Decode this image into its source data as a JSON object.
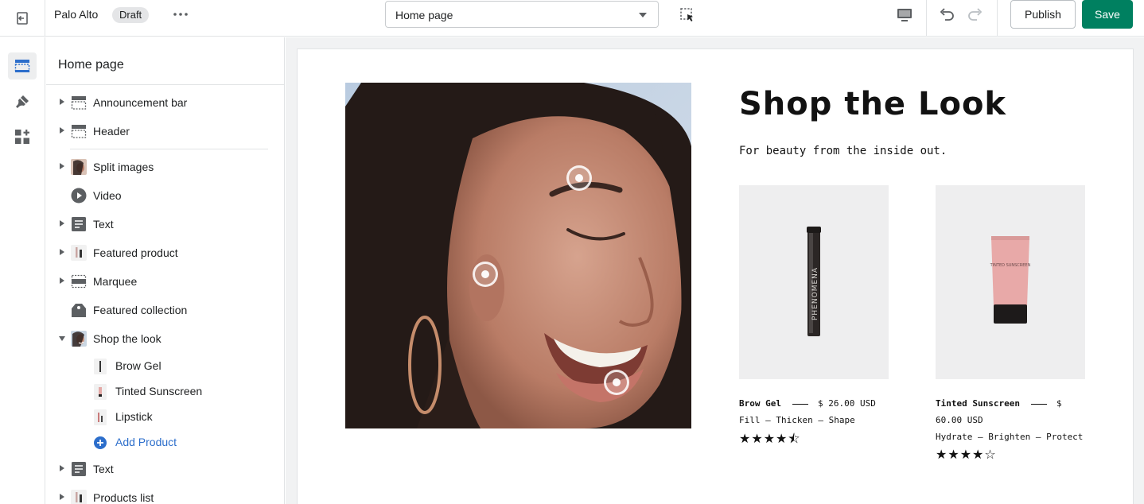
{
  "topbar": {
    "store_name": "Palo Alto",
    "status_badge": "Draft",
    "page_select": "Home page",
    "publish_label": "Publish",
    "save_label": "Save"
  },
  "sidebar": {
    "title": "Home page",
    "sections": [
      {
        "label": "Announcement bar",
        "icon": "section-icon"
      },
      {
        "label": "Header",
        "icon": "section-icon"
      },
      {
        "label": "Split images",
        "icon": "image-thumbnail"
      },
      {
        "label": "Video",
        "icon": "play-icon"
      },
      {
        "label": "Text",
        "icon": "text-icon"
      },
      {
        "label": "Featured product",
        "icon": "product-thumbnail"
      },
      {
        "label": "Marquee",
        "icon": "marquee-icon"
      },
      {
        "label": "Featured collection",
        "icon": "collection-tag-icon"
      },
      {
        "label": "Shop the look",
        "icon": "image-thumbnail"
      },
      {
        "label": "Text",
        "icon": "text-icon"
      },
      {
        "label": "Products list",
        "icon": "product-thumbnail"
      }
    ],
    "blocks": [
      {
        "label": "Brow Gel"
      },
      {
        "label": "Tinted Sunscreen"
      },
      {
        "label": "Lipstick"
      }
    ],
    "add_product": "Add Product"
  },
  "preview": {
    "title": "Shop the Look",
    "subtitle": "For beauty from the inside out.",
    "products": [
      {
        "name": "Brow Gel",
        "price_line1": "$ 26.00 USD",
        "price_line2": "",
        "tagline": "Fill – Thicken – Shape",
        "rating": 4.5,
        "stars": "★★★★⯪"
      },
      {
        "name": "Tinted Sunscreen",
        "price_line1": "$",
        "price_line2": "60.00 USD",
        "tagline": "Hydrate – Brighten – Protect",
        "rating": 4,
        "stars": "★★★★☆"
      }
    ],
    "product_labels": [
      "PHENOMENA",
      "TINTED SUNSCREEN"
    ]
  },
  "colors": {
    "accent": "#008060",
    "link": "#2c6ecb",
    "border": "#e1e3e5"
  }
}
